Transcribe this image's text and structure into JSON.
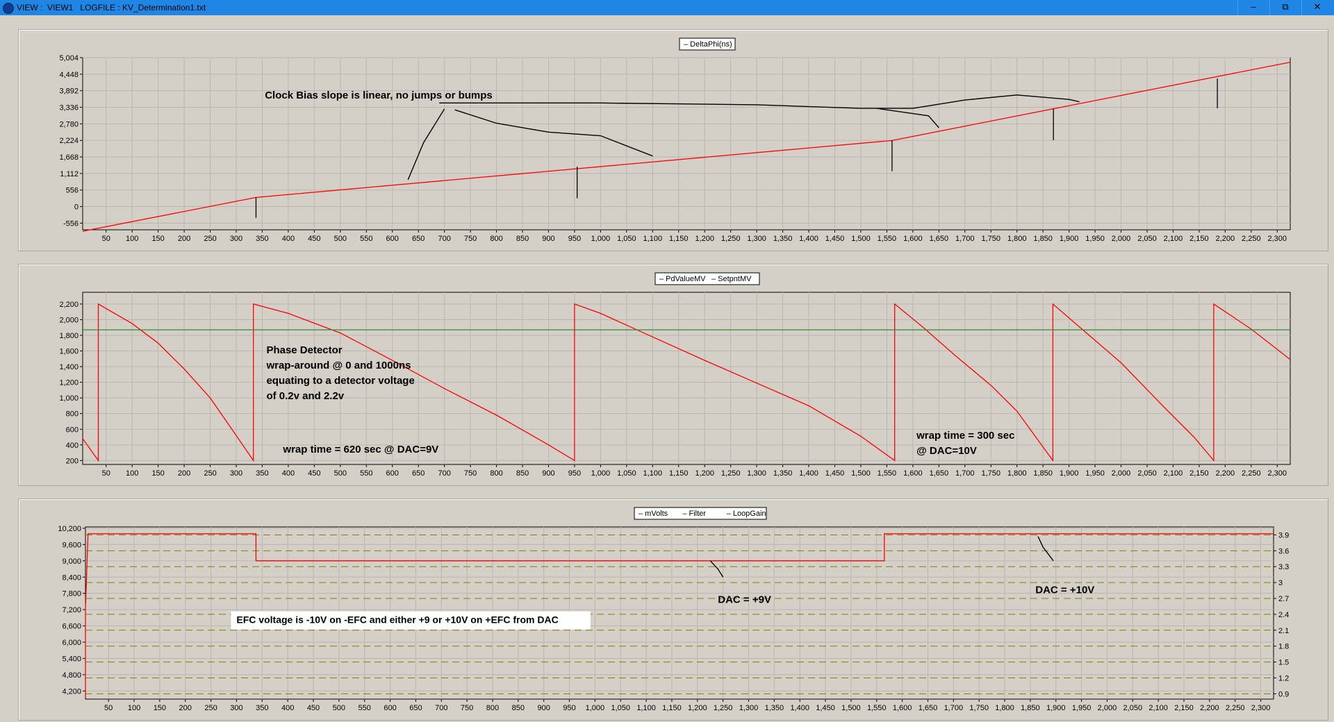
{
  "window": {
    "title": "VIEW :  VIEW1   LOGFILE : KV_Determination1.txt",
    "buttons": {
      "minimize": "–",
      "maximize": "⧉",
      "close": "✕"
    },
    "colors": {
      "titlebar": "#1f86e6",
      "background": "#d4d0c8",
      "plot_background": "#d4d0c8"
    }
  },
  "chart_data": [
    {
      "type": "line",
      "title": "",
      "legend": [
        "DeltaPhi(ns)"
      ],
      "legend_placement": "top-center",
      "xlabel": "",
      "ylabel": "",
      "xlim": [
        5,
        2325
      ],
      "ylim": [
        -780,
        5004
      ],
      "x_ticks": [
        50,
        100,
        150,
        200,
        250,
        300,
        350,
        400,
        450,
        500,
        550,
        600,
        650,
        700,
        750,
        800,
        850,
        900,
        950,
        1000,
        1050,
        1100,
        1150,
        1200,
        1250,
        1300,
        1350,
        1400,
        1450,
        1500,
        1550,
        1600,
        1650,
        1700,
        1750,
        1800,
        1850,
        1900,
        1950,
        2000,
        2050,
        2100,
        2150,
        2200,
        2250,
        2300
      ],
      "x_tick_labels": [
        "50",
        "100",
        "150",
        "200",
        "250",
        "300",
        "350",
        "400",
        "450",
        "500",
        "550",
        "600",
        "650",
        "700",
        "750",
        "800",
        "850",
        "900",
        "950",
        "1,000",
        "1,050",
        "1,100",
        "1,150",
        "1,200",
        "1,250",
        "1,300",
        "1,350",
        "1,400",
        "1,450",
        "1,500",
        "1,550",
        "1,600",
        "1,650",
        "1,700",
        "1,750",
        "1,800",
        "1,850",
        "1,900",
        "1,950",
        "2,000",
        "2,050",
        "2,100",
        "2,150",
        "2,200",
        "2,250",
        "2,300"
      ],
      "y_ticks": [
        -556,
        0,
        556,
        1112,
        1668,
        2224,
        2780,
        3336,
        3892,
        4448,
        5004
      ],
      "y_tick_labels": [
        "-556",
        "0",
        "556",
        "1,112",
        "1,668",
        "2,224",
        "2,780",
        "3,336",
        "3,892",
        "4,448",
        "5,004"
      ],
      "grid": true,
      "series": [
        {
          "name": "DeltaPhi(ns)",
          "color": "#ff0000",
          "x": [
            5,
            338,
            1560,
            2325
          ],
          "y": [
            -830,
            306,
            2220,
            4850
          ]
        }
      ],
      "spikes": [
        {
          "x": 338,
          "y_from": 306,
          "y_to": -380,
          "color": "#000000"
        },
        {
          "x": 955,
          "y_from": 1340,
          "y_to": 280,
          "color": "#000000"
        },
        {
          "x": 1560,
          "y_from": 2220,
          "y_to": 1190,
          "color": "#000000"
        },
        {
          "x": 1870,
          "y_from": 3290,
          "y_to": 2230,
          "color": "#000000"
        },
        {
          "x": 2185,
          "y_from": 4300,
          "y_to": 3300,
          "color": "#000000"
        }
      ],
      "annotations": [
        {
          "text": "Clock Bias slope is linear, no jumps or bumps",
          "x": 355,
          "y": 3630
        }
      ]
    },
    {
      "type": "line",
      "title": "",
      "legend": [
        "PdValueMV",
        "SetpntMV"
      ],
      "legend_placement": "top-center",
      "xlabel": "",
      "ylabel": "",
      "xlim": [
        5,
        2325
      ],
      "ylim": [
        150,
        2350
      ],
      "x_ticks": [
        50,
        100,
        150,
        200,
        250,
        300,
        350,
        400,
        450,
        500,
        550,
        600,
        650,
        700,
        750,
        800,
        850,
        900,
        950,
        1000,
        1050,
        1100,
        1150,
        1200,
        1250,
        1300,
        1350,
        1400,
        1450,
        1500,
        1550,
        1600,
        1650,
        1700,
        1750,
        1800,
        1850,
        1900,
        1950,
        2000,
        2050,
        2100,
        2150,
        2200,
        2250,
        2300
      ],
      "x_tick_labels": [
        "50",
        "100",
        "150",
        "200",
        "250",
        "300",
        "350",
        "400",
        "450",
        "500",
        "550",
        "600",
        "650",
        "700",
        "750",
        "800",
        "850",
        "900",
        "950",
        "1,000",
        "1,050",
        "1,100",
        "1,150",
        "1,200",
        "1,250",
        "1,300",
        "1,350",
        "1,400",
        "1,450",
        "1,500",
        "1,550",
        "1,600",
        "1,650",
        "1,700",
        "1,750",
        "1,800",
        "1,850",
        "1,900",
        "1,950",
        "2,000",
        "2,050",
        "2,100",
        "2,150",
        "2,200",
        "2,250",
        "2,300"
      ],
      "y_ticks": [
        200,
        400,
        600,
        800,
        1000,
        1200,
        1400,
        1600,
        1800,
        2000,
        2200
      ],
      "y_tick_labels": [
        "200",
        "400",
        "600",
        "800",
        "1,000",
        "1,200",
        "1,400",
        "1,600",
        "1,800",
        "2,000",
        "2,200"
      ],
      "grid": true,
      "series": [
        {
          "name": "PdValueMV",
          "color": "#ff0000",
          "x": [
            5,
            35,
            35,
            100,
            150,
            200,
            250,
            300,
            333,
            333,
            400,
            500,
            600,
            700,
            800,
            900,
            950,
            950,
            1000,
            1100,
            1200,
            1300,
            1400,
            1500,
            1565,
            1565,
            1620,
            1680,
            1750,
            1800,
            1869,
            1869,
            1930,
            2000,
            2080,
            2140,
            2178,
            2178,
            2250,
            2325
          ],
          "y": [
            480,
            200,
            2200,
            1950,
            1700,
            1370,
            1000,
            520,
            200,
            2200,
            2080,
            1830,
            1480,
            1120,
            780,
            400,
            200,
            2200,
            2080,
            1780,
            1480,
            1190,
            900,
            510,
            200,
            2200,
            1900,
            1550,
            1160,
            830,
            200,
            2200,
            1850,
            1450,
            900,
            500,
            200,
            2200,
            1880,
            1490
          ]
        },
        {
          "name": "SetpntMV",
          "color": "#2e8b2e",
          "x": [
            5,
            2325
          ],
          "y": [
            1870,
            1870
          ]
        }
      ],
      "annotations": [
        {
          "lines": [
            "Phase Detector",
            "wrap-around @ 0 and 1000ns",
            "equating to a detector voltage",
            "of 0.2v and 2.2v"
          ],
          "x": 358,
          "y": 1570
        },
        {
          "text": "wrap time = 620 sec @ DAC=9V",
          "x": 390,
          "y": 300
        },
        {
          "lines": [
            "wrap time = 300 sec",
            "@ DAC=10V"
          ],
          "x": 1607,
          "y": 480
        }
      ]
    },
    {
      "type": "line",
      "title": "",
      "legend": [
        "mVolts",
        "Filter",
        "LoopGain"
      ],
      "legend_placement": "top-center",
      "xlabel": "",
      "ylabel": "",
      "xlim": [
        5,
        2325
      ],
      "ylim": [
        3900,
        10250
      ],
      "y2lim": [
        0.8,
        4.05
      ],
      "x_ticks": [
        50,
        100,
        150,
        200,
        250,
        300,
        350,
        400,
        450,
        500,
        550,
        600,
        650,
        700,
        750,
        800,
        850,
        900,
        950,
        1000,
        1050,
        1100,
        1150,
        1200,
        1250,
        1300,
        1350,
        1400,
        1450,
        1500,
        1550,
        1600,
        1650,
        1700,
        1750,
        1800,
        1850,
        1900,
        1950,
        2000,
        2050,
        2100,
        2150,
        2200,
        2250,
        2300
      ],
      "x_tick_labels": [
        "50",
        "100",
        "150",
        "200",
        "250",
        "300",
        "350",
        "400",
        "450",
        "500",
        "550",
        "600",
        "650",
        "700",
        "750",
        "800",
        "850",
        "900",
        "950",
        "1,000",
        "1,050",
        "1,100",
        "1,150",
        "1,200",
        "1,250",
        "1,300",
        "1,350",
        "1,400",
        "1,450",
        "1,500",
        "1,550",
        "1,600",
        "1,650",
        "1,700",
        "1,750",
        "1,800",
        "1,850",
        "1,900",
        "1,950",
        "2,000",
        "2,050",
        "2,100",
        "2,150",
        "2,200",
        "2,250",
        "2,300"
      ],
      "y_ticks": [
        4200,
        4800,
        5400,
        6000,
        6600,
        7200,
        7800,
        8400,
        9000,
        9600,
        10200
      ],
      "y_tick_labels": [
        "4,200",
        "4,800",
        "5,400",
        "6,000",
        "6,600",
        "7,200",
        "7,800",
        "8,400",
        "9,000",
        "9,600",
        "10,200"
      ],
      "y2_ticks": [
        0.9,
        1.2,
        1.5,
        1.8,
        2.1,
        2.4,
        2.7,
        3,
        3.3,
        3.6,
        3.9
      ],
      "y2_tick_labels": [
        "0.9",
        "1.2",
        "1.5",
        "1.8",
        "2.1",
        "2.4",
        "2.7",
        "3",
        "3.3",
        "3.6",
        "3.9"
      ],
      "grid": true,
      "series": [
        {
          "name": "mVolts",
          "color": "#ff0000",
          "x": [
            5,
            5,
            10,
            338,
            338,
            1565,
            1565,
            2325
          ],
          "y": [
            3950,
            7200,
            10000,
            10000,
            9000,
            9000,
            10000,
            10000
          ]
        },
        {
          "name": "Filter",
          "color": "#7f7f00",
          "dashed_levels": [
            0.9,
            1.2,
            1.5,
            1.8,
            2.1,
            2.4,
            2.7,
            3,
            3.3,
            3.6,
            3.9
          ]
        },
        {
          "name": "LoopGain",
          "color": "#7f7f00"
        }
      ],
      "annotations": [
        {
          "text": "EFC voltage is -10V on -EFC and either +9 or +10V on +EFC from DAC",
          "x": 300,
          "y": 6700,
          "boxed": true
        },
        {
          "text": "DAC = +9V",
          "x": 1240,
          "y": 7450
        },
        {
          "text": "DAC = +10V",
          "x": 1860,
          "y": 7800
        }
      ]
    }
  ]
}
